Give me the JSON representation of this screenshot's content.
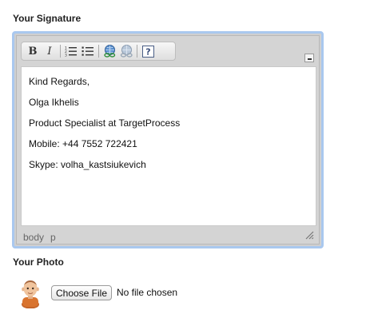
{
  "signature": {
    "label": "Your Signature",
    "lines": [
      "Kind Regards,",
      "Olga Ikhelis",
      "Product Specialist at TargetProcess",
      "Mobile: +44 7552 722421",
      "Skype: volha_kastsiukevich"
    ],
    "toolbar": {
      "bold": "B",
      "italic": "I",
      "help": "?"
    },
    "status_path": [
      "body",
      "p"
    ]
  },
  "photo": {
    "label": "Your Photo",
    "choose_button": "Choose File",
    "file_status": "No file chosen"
  },
  "colors": {
    "frame_border": "#a9c8ef",
    "editor_bg": "#d4d4d4",
    "link_icon": "#2f6fb3"
  },
  "icons": [
    "bold-icon",
    "italic-icon",
    "ordered-list-icon",
    "unordered-list-icon",
    "link-icon",
    "unlink-icon",
    "help-icon",
    "collapse-icon",
    "resize-grip-icon"
  ]
}
